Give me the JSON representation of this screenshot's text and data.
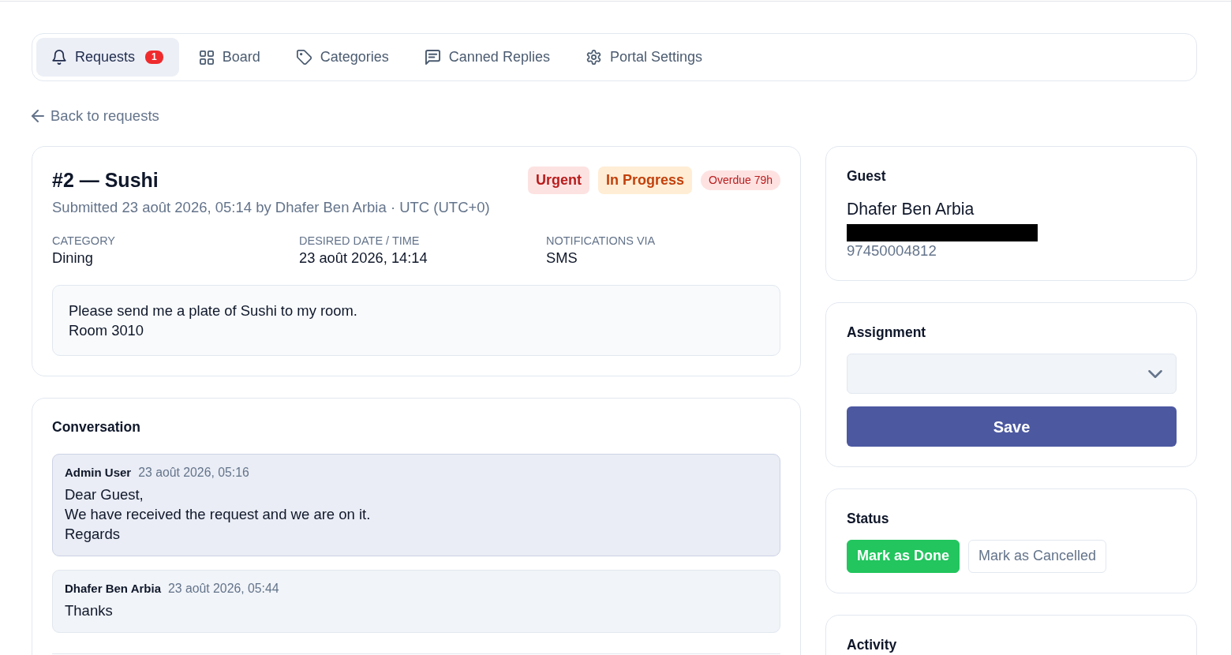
{
  "tabs": [
    {
      "label": "Requests",
      "badge": "1",
      "selected": true
    },
    {
      "label": "Board",
      "selected": false
    },
    {
      "label": "Categories",
      "selected": false
    },
    {
      "label": "Canned Replies",
      "selected": false
    },
    {
      "label": "Portal Settings",
      "selected": false
    }
  ],
  "back_link": {
    "label": "Back to requests"
  },
  "request": {
    "title": "#2 — Sushi",
    "badges": [
      {
        "label": "Urgent",
        "kind": "priority"
      },
      {
        "label": "In Progress",
        "kind": "status"
      },
      {
        "label": "Overdue 79h",
        "kind": "overdue"
      }
    ],
    "submitted": "Submitted 23 août 2026, 05:14 by Dhafer Ben Arbia · UTC (UTC+0)",
    "fields": [
      {
        "label": "CATEGORY",
        "value": "Dining"
      },
      {
        "label": "DESIRED DATE / TIME",
        "value": "23 août 2026, 14:14"
      },
      {
        "label": "NOTIFICATIONS VIA",
        "value": "SMS"
      }
    ],
    "message": "Please send me a plate of Sushi to my room.\nRoom 3010"
  },
  "conversation": {
    "title": "Conversation",
    "messages": [
      {
        "kind": "staff",
        "author": "Admin User",
        "time": "23 août 2026, 05:16",
        "text": "Dear Guest,\nWe have received the request and we are on it.\nRegards"
      },
      {
        "kind": "guest",
        "author": "Dhafer Ben Arbia",
        "time": "23 août 2026, 05:44",
        "text": "Thanks"
      }
    ]
  },
  "guest": {
    "title": "Guest",
    "name": "Dhafer Ben Arbia",
    "contact_redacted": true,
    "phone": "97450004812"
  },
  "assignment": {
    "title": "Assignment",
    "button": "Save"
  },
  "status": {
    "title": "Status",
    "actions": [
      {
        "label": "Mark as Done",
        "kind": "primary"
      },
      {
        "label": "Mark as Cancelled",
        "kind": "outline"
      }
    ]
  },
  "activity": {
    "title": "Activity"
  }
}
